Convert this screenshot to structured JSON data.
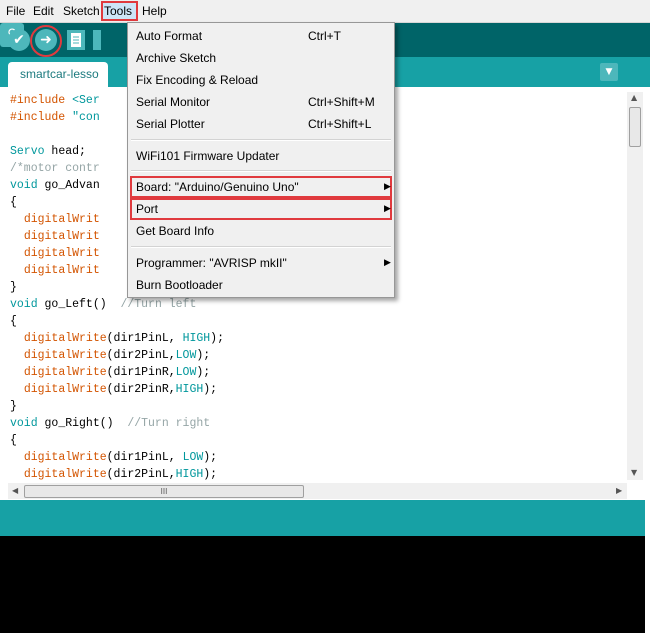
{
  "menubar": {
    "file": "File",
    "edit": "Edit",
    "sketch": "Sketch",
    "tools": "Tools",
    "help": "Help"
  },
  "toolbar": {
    "verify_icon": "checkmark-icon",
    "upload_icon": "arrow-right-icon",
    "new_icon": "document-icon",
    "serial_icon": "magnifier-icon"
  },
  "tab": {
    "label": "smartcar-lesso"
  },
  "code_lines": [
    "#include <Ser",
    "#include \"con",
    "",
    "Servo head;",
    "/*motor contr",
    "void go_Advan",
    "{",
    "  digitalWrit",
    "  digitalWrit",
    "  digitalWrit",
    "  digitalWrit",
    "}",
    "void go_Left()  //Turn left",
    "{",
    "  digitalWrite(dir1PinL, HIGH);",
    "  digitalWrite(dir2PinL,LOW);",
    "  digitalWrite(dir1PinR,LOW);",
    "  digitalWrite(dir2PinR,HIGH);",
    "}",
    "void go_Right()  //Turn right",
    "{",
    "  digitalWrite(dir1PinL, LOW);",
    "  digitalWrite(dir2PinL,HIGH);"
  ],
  "tools_menu": {
    "items": [
      {
        "label": "Auto Format",
        "shortcut": "Ctrl+T"
      },
      {
        "label": "Archive Sketch",
        "shortcut": ""
      },
      {
        "label": "Fix Encoding & Reload",
        "shortcut": ""
      },
      {
        "label": "Serial Monitor",
        "shortcut": "Ctrl+Shift+M"
      },
      {
        "label": "Serial Plotter",
        "shortcut": "Ctrl+Shift+L"
      },
      {
        "label": "WiFi101 Firmware Updater",
        "shortcut": ""
      },
      {
        "label": "Board: \"Arduino/Genuino Uno\"",
        "shortcut": ""
      },
      {
        "label": "Port",
        "shortcut": ""
      },
      {
        "label": "Get Board Info",
        "shortcut": ""
      },
      {
        "label": "Programmer: \"AVRISP mkII\"",
        "shortcut": ""
      },
      {
        "label": "Burn Bootloader",
        "shortcut": ""
      }
    ],
    "submenu_arrow": "▶"
  },
  "scrollbar": {
    "grip": "III",
    "up": "▲",
    "down": "▼",
    "left": "◀",
    "right": "▶"
  },
  "colors": {
    "toolbar": "#006468",
    "tabbar": "#17a1a5",
    "highlight": "#e03a3e",
    "keyword": "#00979c",
    "function": "#d35400",
    "comment": "#95a5a6"
  }
}
